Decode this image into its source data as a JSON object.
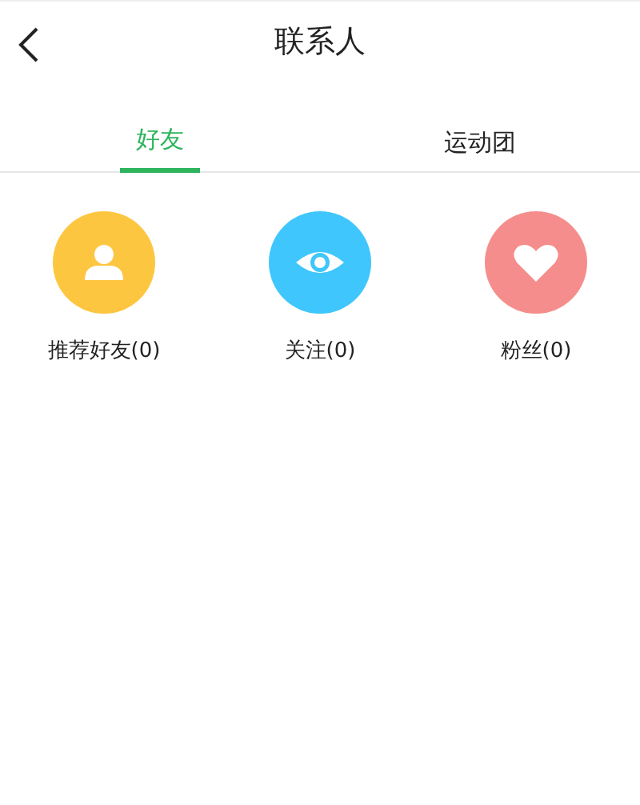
{
  "header": {
    "title": "联系人"
  },
  "tabs": [
    {
      "label": "好友",
      "selected": true
    },
    {
      "label": "运动团",
      "selected": false
    }
  ],
  "shortcuts": [
    {
      "kind": "person",
      "color": "#fdc640",
      "label": "推荐好友(0)"
    },
    {
      "kind": "eye",
      "color": "#3fc6fc",
      "label": "关注(0)"
    },
    {
      "kind": "heart",
      "color": "#f58d8d",
      "label": "粉丝(0)"
    }
  ]
}
